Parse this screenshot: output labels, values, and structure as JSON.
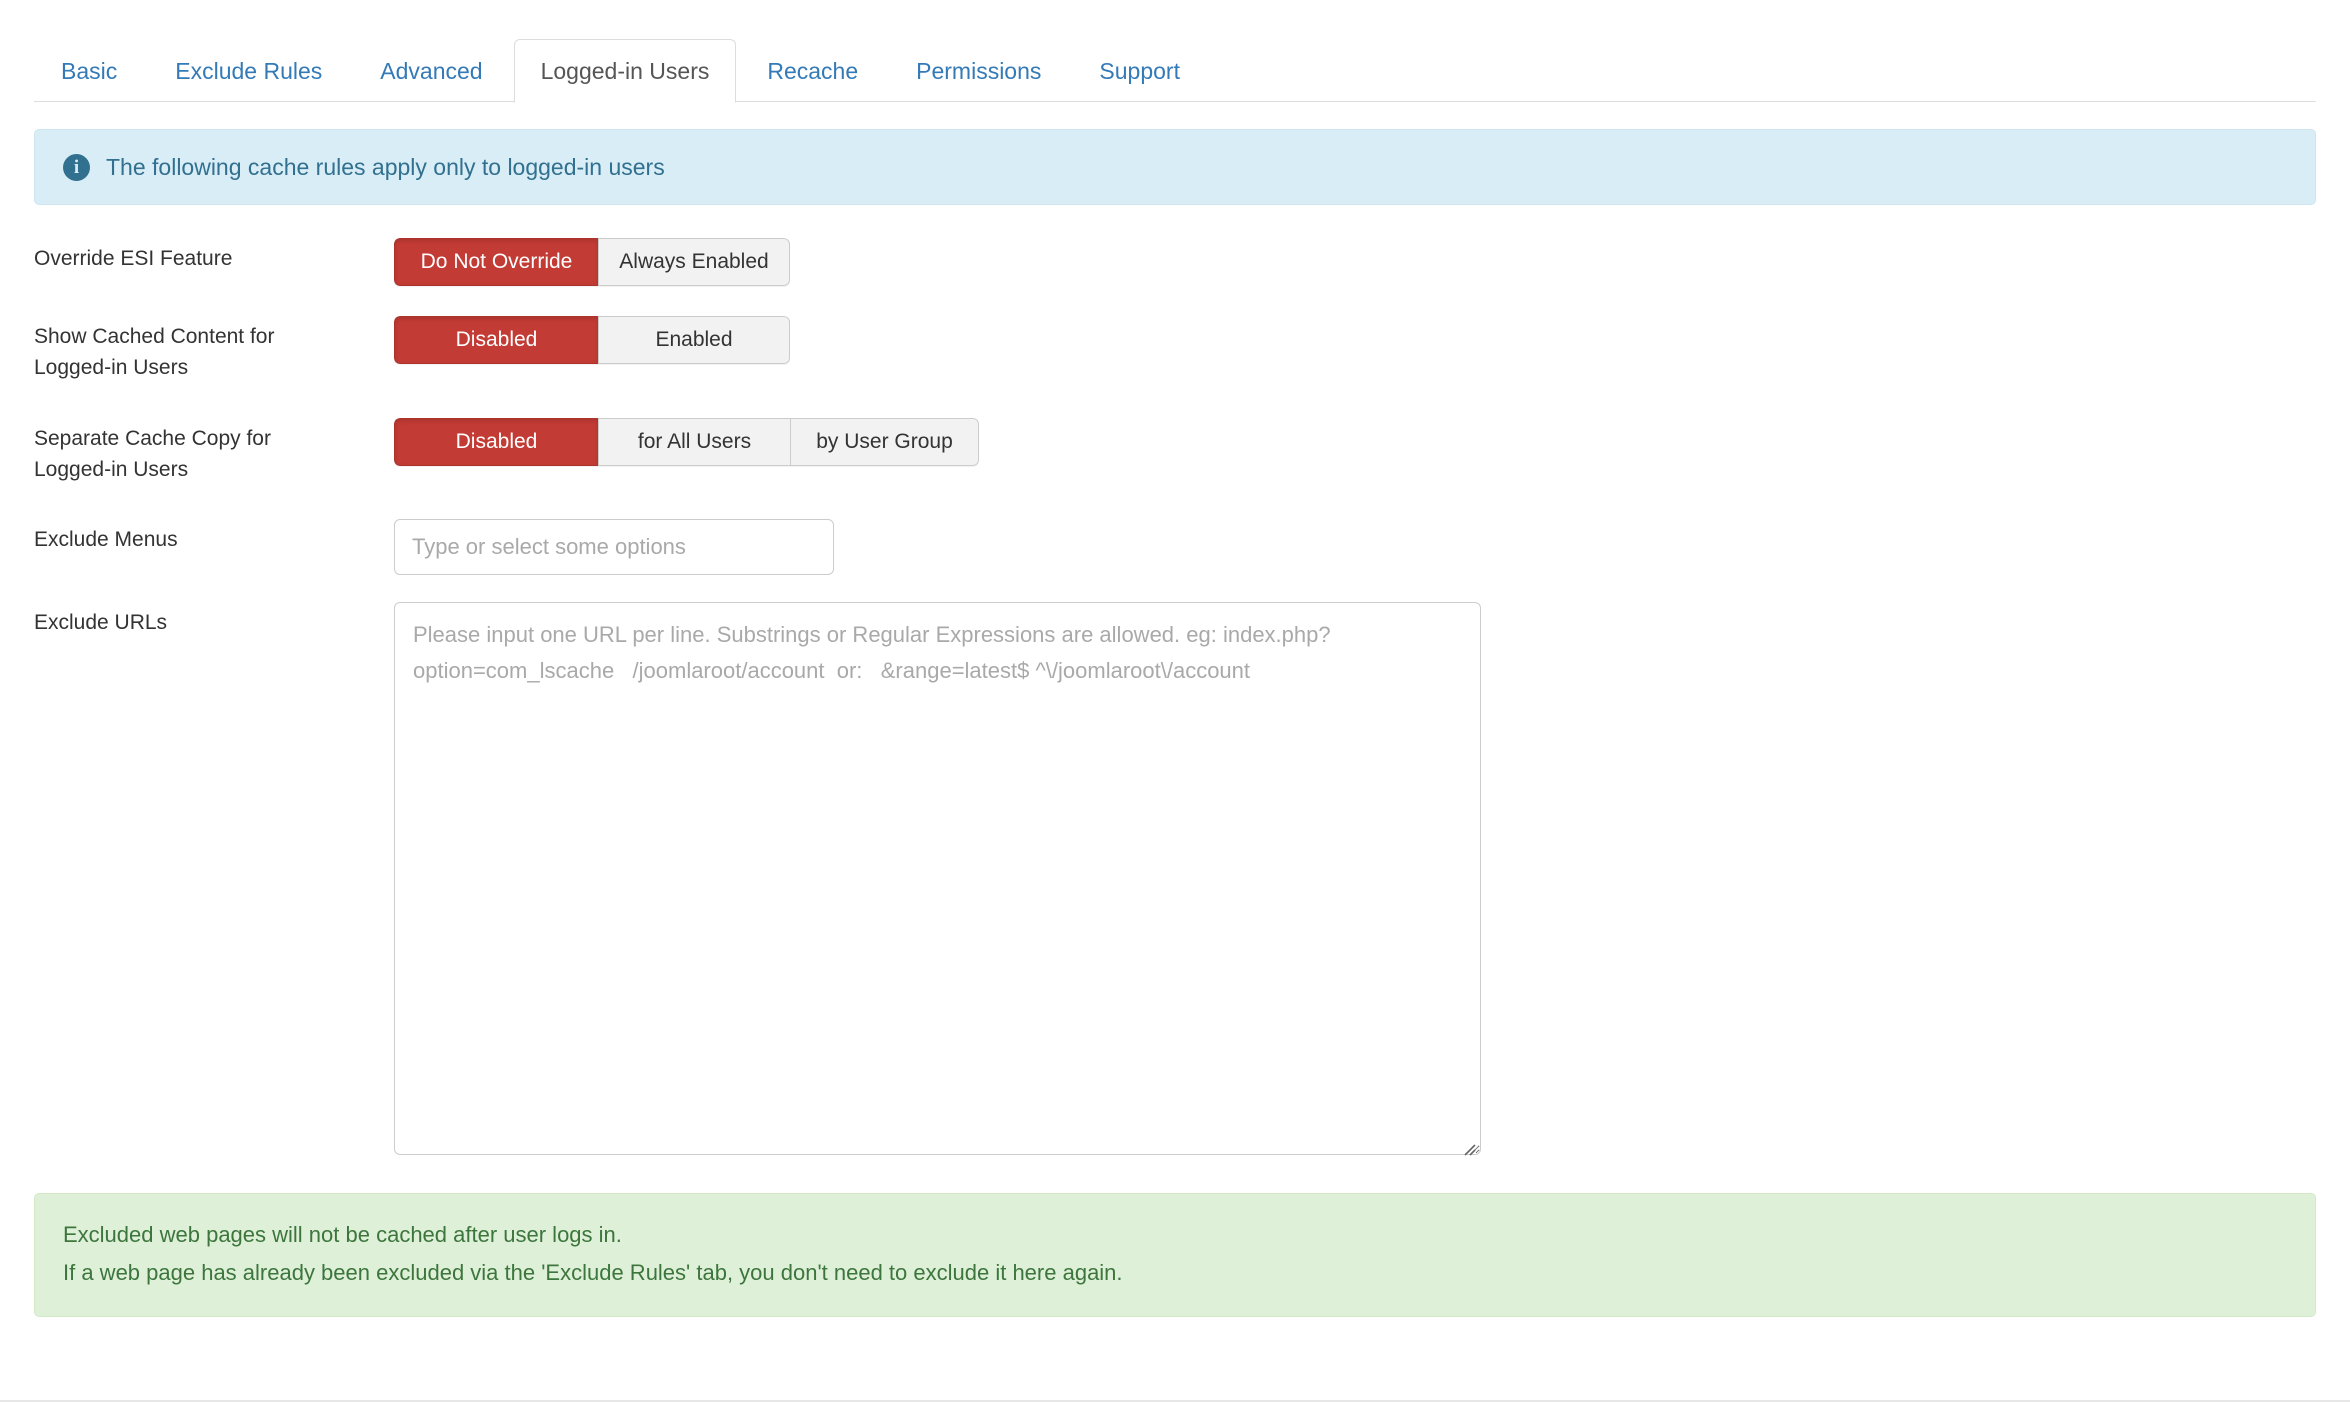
{
  "tabs": [
    {
      "label": "Basic",
      "active": false
    },
    {
      "label": "Exclude Rules",
      "active": false
    },
    {
      "label": "Advanced",
      "active": false
    },
    {
      "label": "Logged-in Users",
      "active": true
    },
    {
      "label": "Recache",
      "active": false
    },
    {
      "label": "Permissions",
      "active": false
    },
    {
      "label": "Support",
      "active": false
    }
  ],
  "info_alert": {
    "icon": "info-circle-icon",
    "text": "The following cache rules apply only to logged-in users",
    "background": "#d9edf7",
    "text_color": "#31708f"
  },
  "fields": {
    "override_esi": {
      "label": "Override ESI Feature",
      "options": [
        "Do Not Override",
        "Always Enabled"
      ],
      "selected": "Do Not Override"
    },
    "show_cached_content": {
      "label": "Show Cached Content for Logged-in Users",
      "label_line1": "Show Cached Content for",
      "label_line2": "Logged-in Users",
      "options": [
        "Disabled",
        "Enabled"
      ],
      "selected": "Disabled"
    },
    "separate_cache_copy": {
      "label": "Separate Cache Copy for Logged-in Users",
      "label_line1": "Separate Cache Copy for",
      "label_line2": "Logged-in Users",
      "options": [
        "Disabled",
        "for All Users",
        "by User Group"
      ],
      "selected": "Disabled"
    },
    "exclude_menus": {
      "label": "Exclude Menus",
      "placeholder": "Type or select some options",
      "value": ""
    },
    "exclude_urls": {
      "label": "Exclude URLs",
      "placeholder": "Please input one URL per line. Substrings or Regular Expressions are allowed. eg: index.php?option=com_lscache   /joomlaroot/account  or:   &range=latest$ ^\\/joomlaroot\\/account",
      "value": ""
    }
  },
  "success_alert": {
    "line1": "Excluded web pages will not be cached after user logs in.",
    "line2": "If a web page has already been excluded via the 'Exclude Rules' tab, you don't need to exclude it here again.",
    "background": "#dff0d8",
    "text_color": "#3c763d"
  },
  "colors": {
    "active_red": "#c23b34",
    "link_blue": "#337ab7",
    "inactive_gray": "#f2f2f2",
    "border_gray": "#cccccc"
  }
}
